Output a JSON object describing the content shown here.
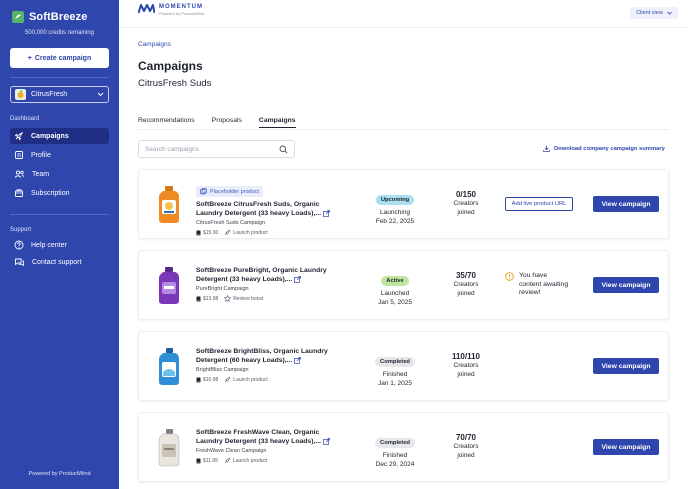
{
  "sidebar": {
    "app_name": "SoftBreeze",
    "credits": "500,000 credits remaining",
    "create_button": "Create campaign",
    "brand_selector": "CitrusFresh",
    "dashboard_label": "Dashboard",
    "nav": [
      {
        "label": "Campaigns",
        "icon": "rocket-icon",
        "active": true
      },
      {
        "label": "Profile",
        "icon": "profile-icon",
        "active": false
      },
      {
        "label": "Team",
        "icon": "team-icon",
        "active": false
      },
      {
        "label": "Subscription",
        "icon": "subscription-icon",
        "active": false
      }
    ],
    "support_label": "Support",
    "support": [
      {
        "label": "Help center",
        "icon": "help-icon"
      },
      {
        "label": "Contact support",
        "icon": "chat-icon"
      }
    ],
    "powered_by": "Powered by ProductWind",
    "colors": {
      "background": "#2f46ad",
      "active_item": "#1f2f86"
    }
  },
  "topbar": {
    "logo_name": "MOMENTUM",
    "logo_sub": "Powered by ProductWind",
    "client_view": "Client view"
  },
  "main": {
    "breadcrumb": "Campaigns",
    "title": "Campaigns",
    "brand": "CitrusFresh Suds",
    "tabs": [
      "Recommendations",
      "Proposals",
      "Campaigns"
    ],
    "active_tab": "Campaigns",
    "search_placeholder": "Search campaigns",
    "download_label": "Download company campaign summary"
  },
  "campaigns": [
    {
      "tag": "Placeholder product",
      "name": "SoftBreeze CitrusFresh Suds, Organic Laundry Detergent (33 heavy Loads),...",
      "campaign": "CitrusFresh Suds Campaign",
      "price": "$15.00",
      "type": "Launch product",
      "status": "Upcoming",
      "status_color": "#a9dff0",
      "status_line1": "Launching",
      "status_line2": "Feb 22, 2025",
      "count": "0/150",
      "creators_line1": "Creators",
      "creators_line2": "joined",
      "action": "Add live product URL",
      "alert": "",
      "view": "View campaign",
      "bottle": "orange"
    },
    {
      "tag": "",
      "name": "SoftBreeze PureBright, Organic Laundry Detergent (33 heavy Loads),...",
      "campaign": "PureBright Campaign",
      "price": "$13.98",
      "type": "Review boost",
      "status": "Active",
      "status_color": "#bfe6a1",
      "status_line1": "Launched",
      "status_line2": "Jan 5, 2025",
      "count": "35/70",
      "creators_line1": "Creators",
      "creators_line2": "joined",
      "action": "",
      "alert": "You have content awaiting review!",
      "view": "View campaign",
      "bottle": "purple"
    },
    {
      "tag": "",
      "name": "SoftBreeze BrightBliss, Organic Laundry Detergent (60 heavy Loads),...",
      "campaign": "BrightBliss Campaign",
      "price": "$10.98",
      "type": "Launch product",
      "status": "Completed",
      "status_color": "#e6e7ea",
      "status_line1": "Finished",
      "status_line2": "Jan 1, 2025",
      "count": "110/110",
      "creators_line1": "Creators",
      "creators_line2": "joined",
      "action": "",
      "alert": "",
      "view": "View campaign",
      "bottle": "blue"
    },
    {
      "tag": "",
      "name": "SoftBreeze FreshWave Clean, Organic Laundry Detergent (33 heavy Loads),...",
      "campaign": "FreshWave Clean Campaign",
      "price": "$11.99",
      "type": "Launch product",
      "status": "Completed",
      "status_color": "#e6e7ea",
      "status_line1": "Finished",
      "status_line2": "Dec 29, 2024",
      "count": "70/70",
      "creators_line1": "Creators",
      "creators_line2": "joined",
      "action": "",
      "alert": "",
      "view": "View campaign",
      "bottle": "white"
    }
  ]
}
